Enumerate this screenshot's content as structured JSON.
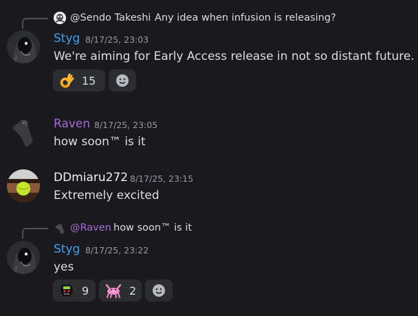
{
  "messages": [
    {
      "reply": {
        "author": "@Sendo Takeshi",
        "text": "Any idea when infusion is releasing?",
        "author_color": "#dbdee1"
      },
      "author": "Styg",
      "author_color": "#3ea3f5",
      "timestamp": "8/17/25, 23:03",
      "content": "We're aiming for Early Access release in not so distant future.",
      "reactions": [
        {
          "emoji": "ok-hand-emoji",
          "count": "15"
        }
      ]
    },
    {
      "author": "Raven",
      "author_color": "#a66ad9",
      "timestamp": "8/17/25, 23:05",
      "content": "how soon™ is it"
    },
    {
      "author": "DDmiaru272",
      "author_color": "#f2f3f5",
      "timestamp": "8/17/25, 23:15",
      "content": "Extremely excited"
    },
    {
      "reply": {
        "author": "@Raven",
        "text": "how soon™ is it",
        "author_color": "#a66ad9"
      },
      "author": "Styg",
      "author_color": "#3ea3f5",
      "timestamp": "8/17/25, 23:22",
      "content": "yes",
      "reactions": [
        {
          "emoji": "monster-custom-emoji",
          "count": "9"
        },
        {
          "emoji": "pink-creature-custom-emoji",
          "count": "2"
        }
      ]
    }
  ]
}
